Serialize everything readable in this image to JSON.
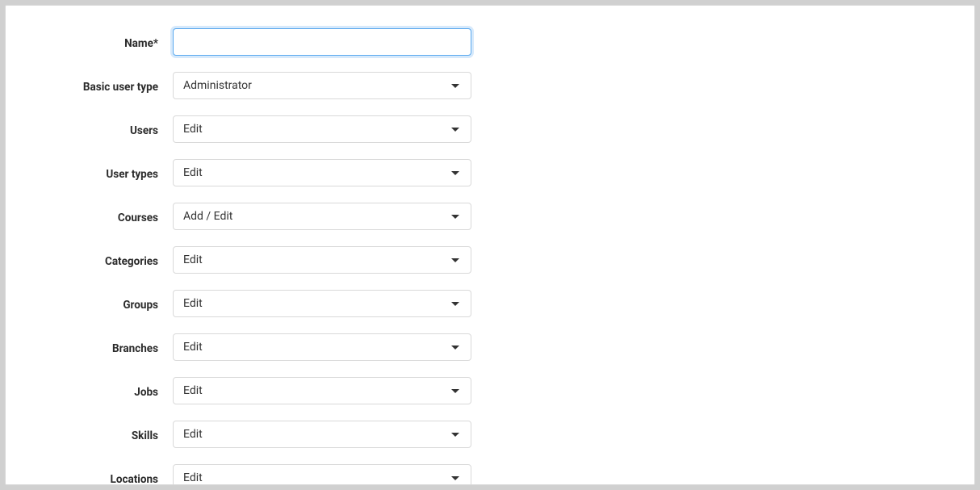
{
  "form": {
    "rows": [
      {
        "id": "name",
        "label": "Name*",
        "type": "text",
        "value": ""
      },
      {
        "id": "basic-user-type",
        "label": "Basic user type",
        "type": "dropdown",
        "value": "Administrator"
      },
      {
        "id": "users",
        "label": "Users",
        "type": "dropdown",
        "value": "Edit"
      },
      {
        "id": "user-types",
        "label": "User types",
        "type": "dropdown",
        "value": "Edit"
      },
      {
        "id": "courses",
        "label": "Courses",
        "type": "dropdown",
        "value": "Add / Edit"
      },
      {
        "id": "categories",
        "label": "Categories",
        "type": "dropdown",
        "value": "Edit"
      },
      {
        "id": "groups",
        "label": "Groups",
        "type": "dropdown",
        "value": "Edit"
      },
      {
        "id": "branches",
        "label": "Branches",
        "type": "dropdown",
        "value": "Edit"
      },
      {
        "id": "jobs",
        "label": "Jobs",
        "type": "dropdown",
        "value": "Edit"
      },
      {
        "id": "skills",
        "label": "Skills",
        "type": "dropdown",
        "value": "Edit"
      },
      {
        "id": "locations",
        "label": "Locations",
        "type": "dropdown",
        "value": "Edit"
      }
    ]
  }
}
